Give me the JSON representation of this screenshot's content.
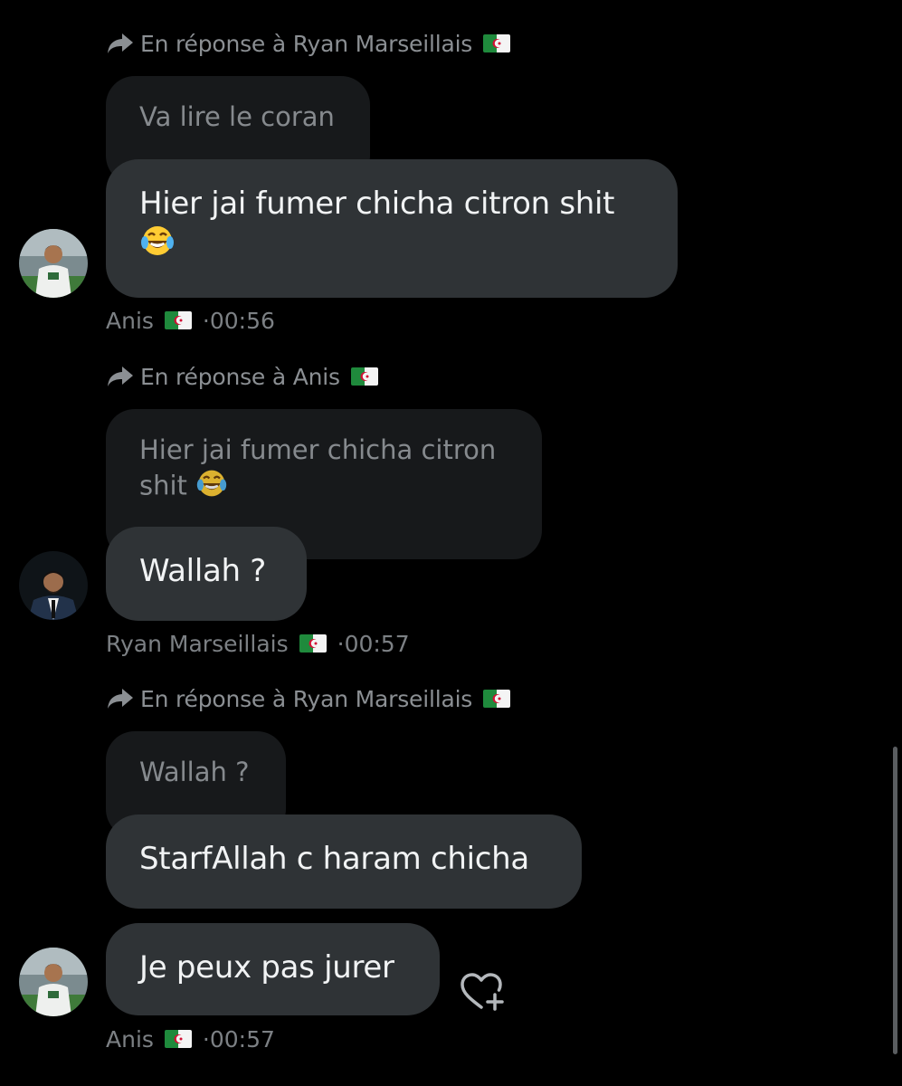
{
  "colors": {
    "background": "#000000",
    "bubble": "#2f3336",
    "quoted_bubble": "#17191b",
    "secondary_text": "#8b8f93"
  },
  "icons": {
    "reply": "reply-arrow-icon",
    "flag": "algeria-flag-icon",
    "emoji": "tears-of-joy-emoji",
    "react": "heart-plus-icon"
  },
  "messages": [
    {
      "reply_to": "En réponse à Ryan Marseillais",
      "quoted": "Va lire le coran",
      "text": "Hier jai fumer chicha citron shit",
      "sender": "Anis",
      "time": "·00:56"
    },
    {
      "reply_to": "En réponse à Anis",
      "quoted": "Hier jai fumer chicha citron shit",
      "text": "Wallah ?",
      "sender": "Ryan Marseillais",
      "time": "·00:57"
    },
    {
      "reply_to": "En réponse à Ryan Marseillais",
      "quoted": "Wallah ?",
      "text": "StarfAllah c haram chicha",
      "text2": "Je peux pas jurer",
      "sender": "Anis",
      "time": "·00:57"
    }
  ]
}
